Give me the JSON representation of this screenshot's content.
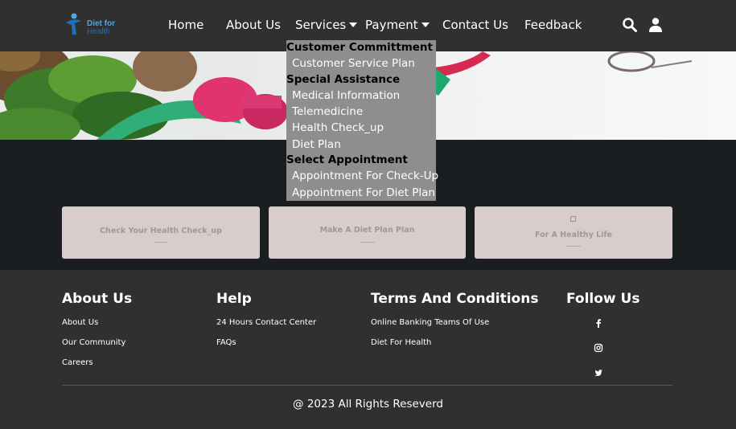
{
  "header": {
    "logo": {
      "line1": "Diet for",
      "line2": "Health"
    },
    "nav": [
      "Home",
      "About Us",
      "Services",
      "Payment",
      "Contact Us",
      "Feedback"
    ],
    "icons": [
      "search-icon",
      "user-icon"
    ]
  },
  "services_menu": {
    "groups": [
      {
        "heading": "Customer Committment",
        "items": [
          "Customer Service Plan"
        ]
      },
      {
        "heading": "Special Assistance",
        "items": [
          "Medical Information",
          "Telemedicine",
          "Health Check_up",
          "Diet Plan"
        ]
      },
      {
        "heading": "Select Appointment",
        "items": [
          "Appointment For Check-Up",
          "Appointment For Diet Plan"
        ]
      }
    ]
  },
  "cards": [
    {
      "label": "Check Your Health Check_up"
    },
    {
      "label": "Make A Diet Plan Plan"
    },
    {
      "label": "For A Healthy Life"
    }
  ],
  "footer": {
    "about": {
      "heading": "About Us",
      "links": [
        "About Us",
        "Our Community",
        "Careers"
      ]
    },
    "help": {
      "heading": "Help",
      "links": [
        "24 Hours Contact Center",
        "FAQs"
      ]
    },
    "terms": {
      "heading": "Terms And Conditions",
      "links": [
        "Online Banking Teams Of Use",
        "Diet For Health"
      ]
    },
    "follow": {
      "heading": "Follow Us",
      "icons": [
        "facebook-icon",
        "instagram-icon",
        "twitter-icon"
      ]
    },
    "copyright": "@ 2023 All Rights Reseverd"
  },
  "colors": {
    "header_bg": "#303030",
    "dropdown_bg": "#8e8e8e",
    "card_bg": "#d9cccc",
    "logo_blue": "#1f6fbf"
  }
}
